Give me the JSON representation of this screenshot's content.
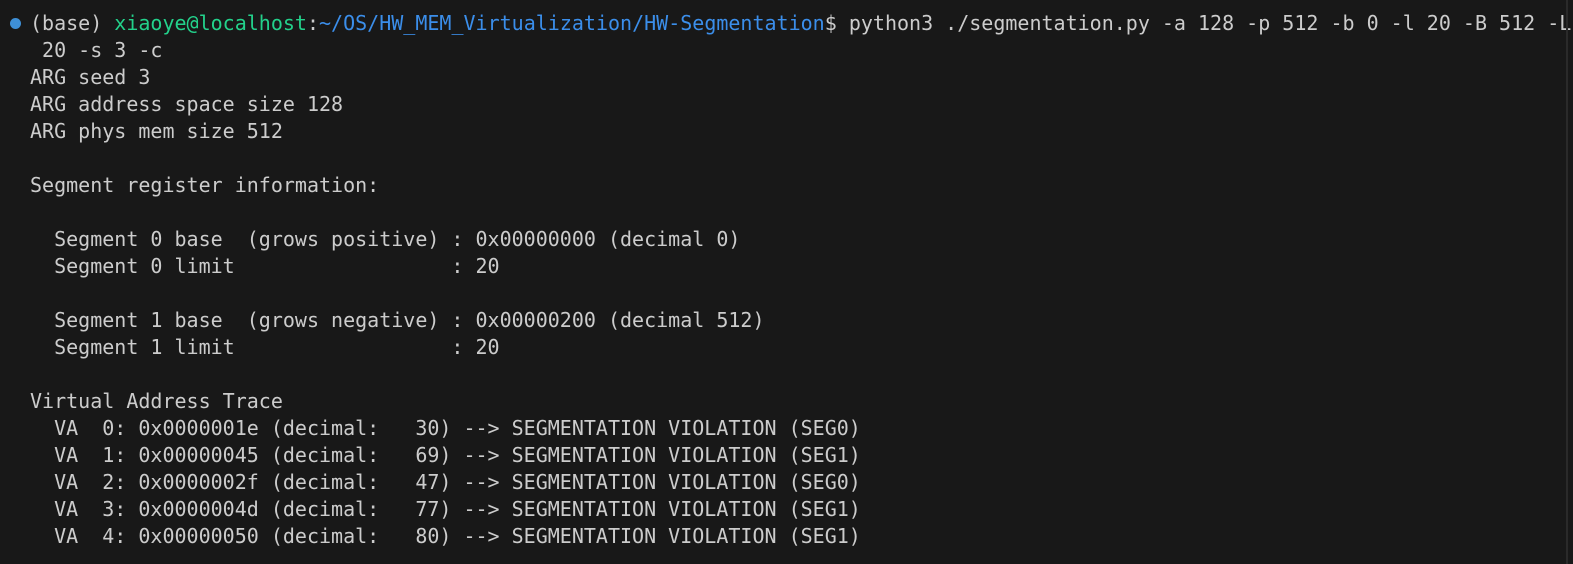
{
  "prompt": {
    "env": "(base) ",
    "user_host": "xiaoye@localhost",
    "sep": ":",
    "path": "~/OS/HW_MEM_Virtualization/HW-Segmentation",
    "symbol": "$ ",
    "command": "python3 ./segmentation.py -a 128 -p 512 -b 0 -l 20 -B 512 -L",
    "command_wrap": " 20 -s 3 -c"
  },
  "output": {
    "seed": "ARG seed 3",
    "asize": "ARG address space size 128",
    "psize": "ARG phys mem size 512",
    "seg_header": "Segment register information:",
    "seg0_base": "  Segment 0 base  (grows positive) : 0x00000000 (decimal 0)",
    "seg0_limit": "  Segment 0 limit                  : 20",
    "seg1_base": "  Segment 1 base  (grows negative) : 0x00000200 (decimal 512)",
    "seg1_limit": "  Segment 1 limit                  : 20",
    "trace_header": "Virtual Address Trace",
    "trace": [
      "  VA  0: 0x0000001e (decimal:   30) --> SEGMENTATION VIOLATION (SEG0)",
      "  VA  1: 0x00000045 (decimal:   69) --> SEGMENTATION VIOLATION (SEG1)",
      "  VA  2: 0x0000002f (decimal:   47) --> SEGMENTATION VIOLATION (SEG0)",
      "  VA  3: 0x0000004d (decimal:   77) --> SEGMENTATION VIOLATION (SEG1)",
      "  VA  4: 0x00000050 (decimal:   80) --> SEGMENTATION VIOLATION (SEG1)"
    ]
  },
  "colors": {
    "background": "#181818",
    "text": "#cccccc",
    "user_host": "#23d18b",
    "path": "#3b8eea",
    "status_dot": "#3e8fd6"
  }
}
